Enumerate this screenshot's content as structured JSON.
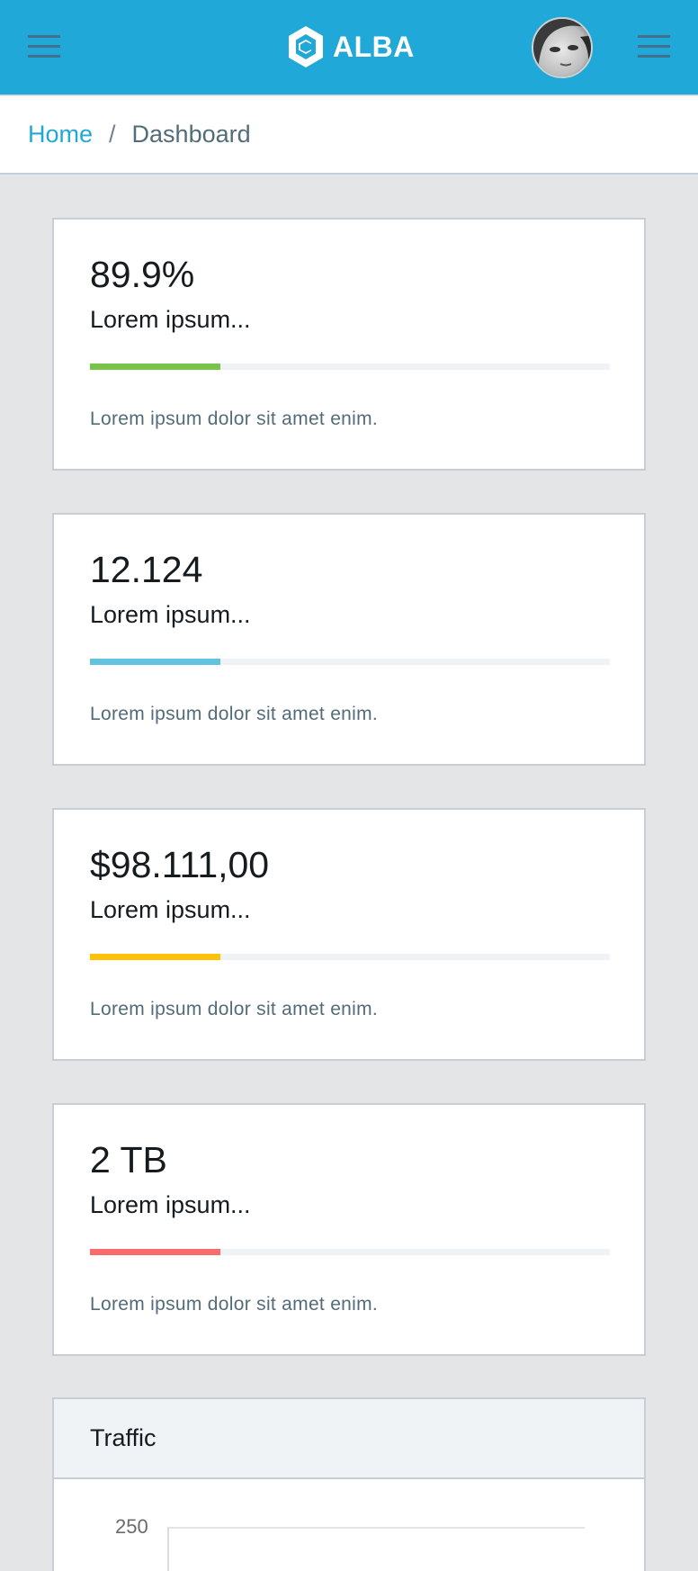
{
  "header": {
    "brand": "ALBA",
    "brand_color": "#20a8d8"
  },
  "breadcrumb": {
    "items": [
      "Home",
      "Dashboard"
    ],
    "separator": "/"
  },
  "cards": [
    {
      "value": "89.9%",
      "label": "Lorem ipsum...",
      "progress": 0.25,
      "color": "#79c447",
      "description": "Lorem ipsum dolor sit amet enim."
    },
    {
      "value": "12.124",
      "label": "Lorem ipsum...",
      "progress": 0.25,
      "color": "#63c2de",
      "description": "Lorem ipsum dolor sit amet enim."
    },
    {
      "value": "$98.111,00",
      "label": "Lorem ipsum...",
      "progress": 0.25,
      "color": "#ffc107",
      "description": "Lorem ipsum dolor sit amet enim."
    },
    {
      "value": "2 TB",
      "label": "Lorem ipsum...",
      "progress": 0.25,
      "color": "#f86c6b",
      "description": "Lorem ipsum dolor sit amet enim."
    }
  ],
  "traffic": {
    "title": "Traffic",
    "chart_data": {
      "type": "line",
      "title": "",
      "ytick_labels": [
        "250"
      ]
    }
  }
}
